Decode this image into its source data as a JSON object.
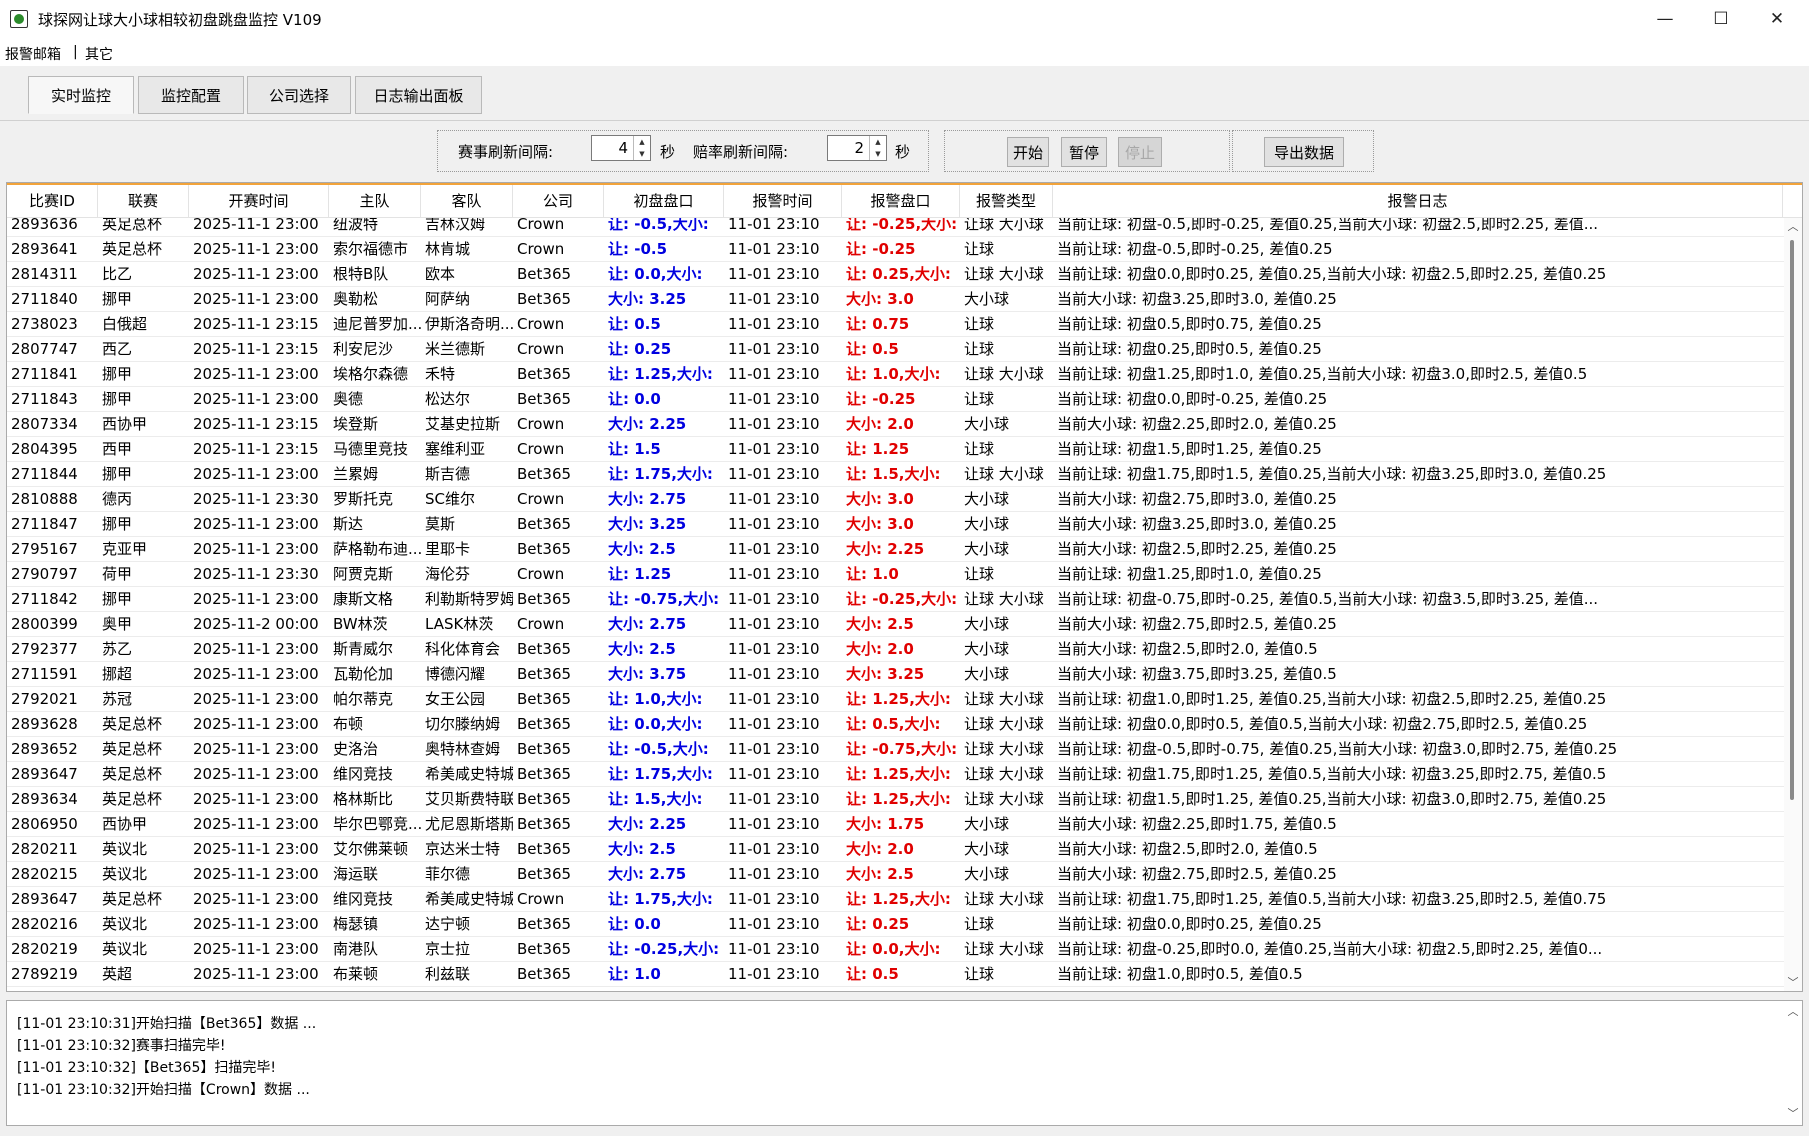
{
  "window": {
    "title": "球探网让球大小球相较初盘跳盘监控 V109",
    "minimize": "—",
    "maximize": "☐",
    "close": "✕"
  },
  "menu": [
    "报警邮箱",
    "|",
    "其它"
  ],
  "tabs": [
    "实时监控",
    "监控配置",
    "公司选择",
    "日志输出面板"
  ],
  "toolbar": {
    "match_refresh_label": "赛事刷新间隔:",
    "match_refresh_value": "4",
    "match_refresh_unit": "秒",
    "odds_refresh_label": "赔率刷新间隔:",
    "odds_refresh_value": "2",
    "odds_refresh_unit": "秒",
    "start": "开始",
    "pause": "暂停",
    "stop": "停止",
    "export": "导出数据"
  },
  "columns": [
    "比赛ID",
    "联赛",
    "开赛时间",
    "主队",
    "客队",
    "公司",
    "初盘盘口",
    "报警时间",
    "报警盘口",
    "报警类型",
    "报警日志"
  ],
  "rows": [
    [
      "2893636",
      "英足总杯",
      "2025-11-1 23:00",
      "纽波特",
      "吉林汉姆",
      "Crown",
      "让: -0.5,大小:",
      "11-01 23:10",
      "让: -0.25,大小:",
      "让球 大小球",
      "当前让球: 初盘-0.5,即时-0.25, 差值0.25,当前大小球: 初盘2.5,即时2.25, 差值..."
    ],
    [
      "2893641",
      "英足总杯",
      "2025-11-1 23:00",
      "索尔福德市",
      "林肯城",
      "Crown",
      "让: -0.5",
      "11-01 23:10",
      "让: -0.25",
      "让球",
      "当前让球: 初盘-0.5,即时-0.25, 差值0.25"
    ],
    [
      "2814311",
      "比乙",
      "2025-11-1 23:00",
      "根特B队",
      "欧本",
      "Bet365",
      "让: 0.0,大小:",
      "11-01 23:10",
      "让: 0.25,大小:",
      "让球 大小球",
      "当前让球: 初盘0.0,即时0.25, 差值0.25,当前大小球: 初盘2.5,即时2.25, 差值0.25"
    ],
    [
      "2711840",
      "挪甲",
      "2025-11-1 23:00",
      "奥勒松",
      "阿萨纳",
      "Bet365",
      "大小: 3.25",
      "11-01 23:10",
      "大小: 3.0",
      "大小球",
      "当前大小球: 初盘3.25,即时3.0, 差值0.25"
    ],
    [
      "2738023",
      "白俄超",
      "2025-11-1 23:15",
      "迪尼普罗加...",
      "伊斯洛奇明...",
      "Crown",
      "让: 0.5",
      "11-01 23:10",
      "让: 0.75",
      "让球",
      "当前让球: 初盘0.5,即时0.75, 差值0.25"
    ],
    [
      "2807747",
      "西乙",
      "2025-11-1 23:15",
      "利安尼沙",
      "米兰德斯",
      "Crown",
      "让: 0.25",
      "11-01 23:10",
      "让: 0.5",
      "让球",
      "当前让球: 初盘0.25,即时0.5, 差值0.25"
    ],
    [
      "2711841",
      "挪甲",
      "2025-11-1 23:00",
      "埃格尔森德",
      "禾特",
      "Bet365",
      "让: 1.25,大小:",
      "11-01 23:10",
      "让: 1.0,大小:",
      "让球 大小球",
      "当前让球: 初盘1.25,即时1.0, 差值0.25,当前大小球: 初盘3.0,即时2.5, 差值0.5"
    ],
    [
      "2711843",
      "挪甲",
      "2025-11-1 23:00",
      "奥德",
      "松达尔",
      "Bet365",
      "让: 0.0",
      "11-01 23:10",
      "让: -0.25",
      "让球",
      "当前让球: 初盘0.0,即时-0.25, 差值0.25"
    ],
    [
      "2807334",
      "西协甲",
      "2025-11-1 23:15",
      "埃登斯",
      "艾基史拉斯",
      "Crown",
      "大小: 2.25",
      "11-01 23:10",
      "大小: 2.0",
      "大小球",
      "当前大小球: 初盘2.25,即时2.0, 差值0.25"
    ],
    [
      "2804395",
      "西甲",
      "2025-11-1 23:15",
      "马德里竞技",
      "塞维利亚",
      "Crown",
      "让: 1.5",
      "11-01 23:10",
      "让: 1.25",
      "让球",
      "当前让球: 初盘1.5,即时1.25, 差值0.25"
    ],
    [
      "2711844",
      "挪甲",
      "2025-11-1 23:00",
      "兰累姆",
      "斯吉德",
      "Bet365",
      "让: 1.75,大小:",
      "11-01 23:10",
      "让: 1.5,大小:",
      "让球 大小球",
      "当前让球: 初盘1.75,即时1.5, 差值0.25,当前大小球: 初盘3.25,即时3.0, 差值0.25"
    ],
    [
      "2810888",
      "德丙",
      "2025-11-1 23:30",
      "罗斯托克",
      "SC维尔",
      "Crown",
      "大小: 2.75",
      "11-01 23:10",
      "大小: 3.0",
      "大小球",
      "当前大小球: 初盘2.75,即时3.0, 差值0.25"
    ],
    [
      "2711847",
      "挪甲",
      "2025-11-1 23:00",
      "斯达",
      "莫斯",
      "Bet365",
      "大小: 3.25",
      "11-01 23:10",
      "大小: 3.0",
      "大小球",
      "当前大小球: 初盘3.25,即时3.0, 差值0.25"
    ],
    [
      "2795167",
      "克亚甲",
      "2025-11-1 23:00",
      "萨格勒布迪...",
      "里耶卡",
      "Bet365",
      "大小: 2.5",
      "11-01 23:10",
      "大小: 2.25",
      "大小球",
      "当前大小球: 初盘2.5,即时2.25, 差值0.25"
    ],
    [
      "2790797",
      "荷甲",
      "2025-11-1 23:30",
      "阿贾克斯",
      "海伦芬",
      "Crown",
      "让: 1.25",
      "11-01 23:10",
      "让: 1.0",
      "让球",
      "当前让球: 初盘1.25,即时1.0, 差值0.25"
    ],
    [
      "2711842",
      "挪甲",
      "2025-11-1 23:00",
      "康斯文格",
      "利勒斯特罗姆",
      "Bet365",
      "让: -0.75,大小:",
      "11-01 23:10",
      "让: -0.25,大小:",
      "让球 大小球",
      "当前让球: 初盘-0.75,即时-0.25, 差值0.5,当前大小球: 初盘3.5,即时3.25, 差值..."
    ],
    [
      "2800399",
      "奥甲",
      "2025-11-2 00:00",
      "BW林茨",
      "LASK林茨",
      "Crown",
      "大小: 2.75",
      "11-01 23:10",
      "大小: 2.5",
      "大小球",
      "当前大小球: 初盘2.75,即时2.5, 差值0.25"
    ],
    [
      "2792377",
      "苏乙",
      "2025-11-1 23:00",
      "斯青威尔",
      "科化体育会",
      "Bet365",
      "大小: 2.5",
      "11-01 23:10",
      "大小: 2.0",
      "大小球",
      "当前大小球: 初盘2.5,即时2.0, 差值0.5"
    ],
    [
      "2711591",
      "挪超",
      "2025-11-1 23:00",
      "瓦勒伦加",
      "博德闪耀",
      "Bet365",
      "大小: 3.75",
      "11-01 23:10",
      "大小: 3.25",
      "大小球",
      "当前大小球: 初盘3.75,即时3.25, 差值0.5"
    ],
    [
      "2792021",
      "苏冠",
      "2025-11-1 23:00",
      "帕尔蒂克",
      "女王公园",
      "Bet365",
      "让: 1.0,大小:",
      "11-01 23:10",
      "让: 1.25,大小:",
      "让球 大小球",
      "当前让球: 初盘1.0,即时1.25, 差值0.25,当前大小球: 初盘2.5,即时2.25, 差值0.25"
    ],
    [
      "2893628",
      "英足总杯",
      "2025-11-1 23:00",
      "布顿",
      "切尔滕纳姆",
      "Bet365",
      "让: 0.0,大小:",
      "11-01 23:10",
      "让: 0.5,大小:",
      "让球 大小球",
      "当前让球: 初盘0.0,即时0.5, 差值0.5,当前大小球: 初盘2.75,即时2.5, 差值0.25"
    ],
    [
      "2893652",
      "英足总杯",
      "2025-11-1 23:00",
      "史洛治",
      "奥特林查姆",
      "Bet365",
      "让: -0.5,大小:",
      "11-01 23:10",
      "让: -0.75,大小:",
      "让球 大小球",
      "当前让球: 初盘-0.5,即时-0.75, 差值0.25,当前大小球: 初盘3.0,即时2.75, 差值0.25"
    ],
    [
      "2893647",
      "英足总杯",
      "2025-11-1 23:00",
      "维冈竞技",
      "希美咸史特城",
      "Bet365",
      "让: 1.75,大小:",
      "11-01 23:10",
      "让: 1.25,大小:",
      "让球 大小球",
      "当前让球: 初盘1.75,即时1.25, 差值0.5,当前大小球: 初盘3.25,即时2.75, 差值0.5"
    ],
    [
      "2893634",
      "英足总杯",
      "2025-11-1 23:00",
      "格林斯比",
      "艾贝斯费特联",
      "Bet365",
      "让: 1.5,大小:",
      "11-01 23:10",
      "让: 1.25,大小:",
      "让球 大小球",
      "当前让球: 初盘1.5,即时1.25, 差值0.25,当前大小球: 初盘3.0,即时2.75, 差值0.25"
    ],
    [
      "2806950",
      "西协甲",
      "2025-11-1 23:00",
      "毕尔巴鄂竞...",
      "尤尼恩斯塔斯",
      "Bet365",
      "大小: 2.25",
      "11-01 23:10",
      "大小: 1.75",
      "大小球",
      "当前大小球: 初盘2.25,即时1.75, 差值0.5"
    ],
    [
      "2820211",
      "英议北",
      "2025-11-1 23:00",
      "艾尔佛莱顿",
      "京达米士特",
      "Bet365",
      "大小: 2.5",
      "11-01 23:10",
      "大小: 2.0",
      "大小球",
      "当前大小球: 初盘2.5,即时2.0, 差值0.5"
    ],
    [
      "2820215",
      "英议北",
      "2025-11-1 23:00",
      "海运联",
      "菲尔德",
      "Bet365",
      "大小: 2.75",
      "11-01 23:10",
      "大小: 2.5",
      "大小球",
      "当前大小球: 初盘2.75,即时2.5, 差值0.25"
    ],
    [
      "2893647",
      "英足总杯",
      "2025-11-1 23:00",
      "维冈竞技",
      "希美咸史特城",
      "Crown",
      "让: 1.75,大小:",
      "11-01 23:10",
      "让: 1.25,大小:",
      "让球 大小球",
      "当前让球: 初盘1.75,即时1.25, 差值0.5,当前大小球: 初盘3.25,即时2.5, 差值0.75"
    ],
    [
      "2820216",
      "英议北",
      "2025-11-1 23:00",
      "梅瑟镇",
      "达宁顿",
      "Bet365",
      "让: 0.0",
      "11-01 23:10",
      "让: 0.25",
      "让球",
      "当前让球: 初盘0.0,即时0.25, 差值0.25"
    ],
    [
      "2820219",
      "英议北",
      "2025-11-1 23:00",
      "南港队",
      "京士拉",
      "Bet365",
      "让: -0.25,大小:",
      "11-01 23:10",
      "让: 0.0,大小:",
      "让球 大小球",
      "当前让球: 初盘-0.25,即时0.0, 差值0.25,当前大小球: 初盘2.5,即时2.25, 差值0..."
    ],
    [
      "2789219",
      "英超",
      "2025-11-1 23:00",
      "布莱顿",
      "利兹联",
      "Bet365",
      "让: 1.0",
      "11-01 23:10",
      "让: 0.5",
      "让球",
      "当前让球: 初盘1.0,即时0.5, 差值0.5"
    ]
  ],
  "log": [
    "[11-01 23:10:31]开始扫描【Bet365】数据 ...",
    "[11-01 23:10:32]赛事扫描完毕!",
    "[11-01 23:10:32]【Bet365】扫描完毕!",
    "[11-01 23:10:32]开始扫描【Crown】数据 ..."
  ],
  "colors": {
    "initial_odds": "#0000e0",
    "alarm_odds": "#e00000",
    "header_accent": "#f2a33a"
  },
  "icons": {
    "app": "football-icon",
    "scroll_up": "chevron-up-icon",
    "scroll_down": "chevron-down-icon"
  }
}
